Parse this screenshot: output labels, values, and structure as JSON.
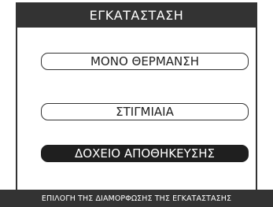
{
  "header": {
    "title": "ΕΓΚΑΤΑΣΤΑΣΗ"
  },
  "options": [
    {
      "label": "ΜΟΝΟ ΘΕΡΜΑΝΣΗ",
      "selected": false
    },
    {
      "label": "ΣΤΙΓΜΙΑΙΑ",
      "selected": false
    },
    {
      "label": "ΔΟΧΕΙΟ ΑΠΟΘΗΚΕΥΣΗΣ",
      "selected": true
    }
  ],
  "footer": {
    "hint": "ΕΠΙΛΟΓΗ ΤΗΣ ΔΙΑΜΟΡΦΩΣΗΣ ΤΗΣ ΕΓΚΑΤΑΣΤΑΣΗΣ"
  },
  "colors": {
    "bar": "#333333",
    "selected_bg": "#1f1f1f",
    "background": "#ffffff"
  }
}
